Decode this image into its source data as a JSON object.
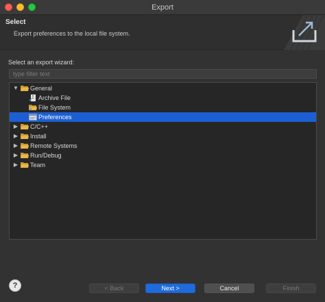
{
  "window": {
    "title": "Export"
  },
  "banner": {
    "title": "Select",
    "description": "Export preferences to the local file system."
  },
  "wizard": {
    "label": "Select an export wizard:",
    "filter_placeholder": "type filter text"
  },
  "tree": {
    "general": "General",
    "archive_file": "Archive File",
    "file_system": "File System",
    "preferences": "Preferences",
    "c_cpp": "C/C++",
    "install": "Install",
    "remote_systems": "Remote Systems",
    "run_debug": "Run/Debug",
    "team": "Team"
  },
  "buttons": {
    "help": "?",
    "back": "< Back",
    "next": "Next >",
    "cancel": "Cancel",
    "finish": "Finish"
  },
  "colors": {
    "selection": "#1d5fd2",
    "primary_button": "#1f6bdc",
    "folder": "#e9b64a",
    "close": "#fe5f57",
    "minimize": "#febc2e",
    "maximize": "#28c840"
  },
  "icons": {
    "expanded": "triangle-down",
    "collapsed": "triangle-right",
    "folder": "folder-icon",
    "archive": "archive-file-icon",
    "filesystem": "file-system-icon",
    "preferences": "preferences-icon"
  }
}
